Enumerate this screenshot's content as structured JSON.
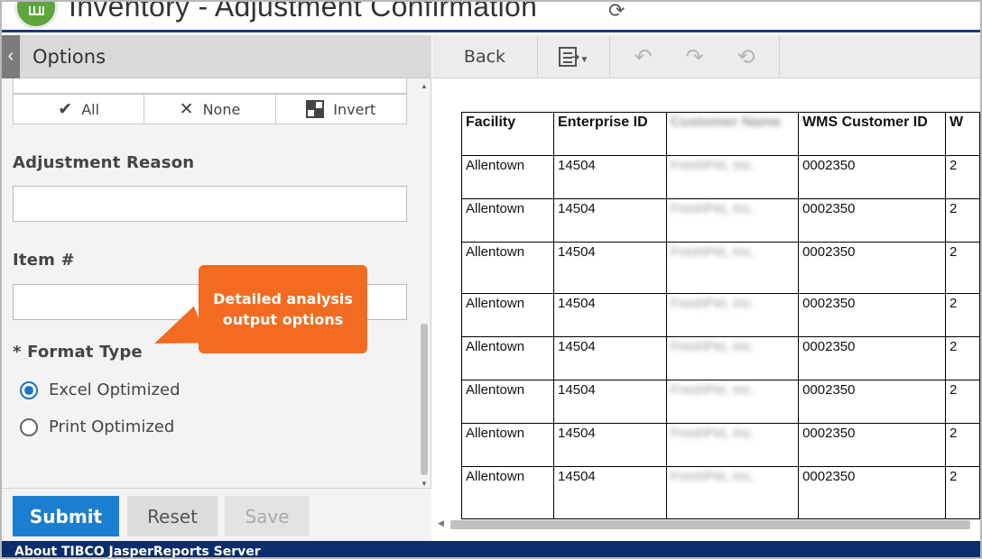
{
  "app": {
    "title": "Inventory - Adjustment Confirmation"
  },
  "options_panel": {
    "title": "Options",
    "select_buttons": {
      "all": "All",
      "none": "None",
      "invert": "Invert"
    },
    "adjustment_reason": {
      "label": "Adjustment Reason",
      "value": ""
    },
    "item_number": {
      "label": "Item #",
      "value": ""
    },
    "format_type": {
      "label": "* Format Type",
      "options": [
        {
          "label": "Excel Optimized",
          "selected": true
        },
        {
          "label": "Print Optimized",
          "selected": false
        }
      ]
    },
    "buttons": {
      "submit": "Submit",
      "reset": "Reset",
      "save": "Save"
    }
  },
  "callout": {
    "line1": "Detailed analysis",
    "line2": "output options"
  },
  "viewer_toolbar": {
    "back": "Back"
  },
  "report": {
    "columns": [
      "Facility",
      "Enterprise ID",
      "Customer Name",
      "WMS Customer ID",
      "W"
    ],
    "rows": [
      [
        "Allentown",
        "14504",
        "FreshPet, Inc.",
        "0002350",
        "2"
      ],
      [
        "Allentown",
        "14504",
        "FreshPet, Inc.",
        "0002350",
        "2"
      ],
      [
        "Allentown",
        "14504",
        "FreshPet, Inc.",
        "0002350",
        "2"
      ],
      [
        "Allentown",
        "14504",
        "FreshPet, Inc.",
        "0002350",
        "2"
      ],
      [
        "Allentown",
        "14504",
        "FreshPet, Inc.",
        "0002350",
        "2"
      ],
      [
        "Allentown",
        "14504",
        "FreshPet, Inc.",
        "0002350",
        "2"
      ],
      [
        "Allentown",
        "14504",
        "FreshPet, Inc.",
        "0002350",
        "2"
      ],
      [
        "Allentown",
        "14504",
        "FreshPet, Inc.",
        "0002350",
        "2"
      ]
    ]
  },
  "footer": {
    "about": "About TIBCO JasperReports Server"
  },
  "colors": {
    "header_underline": "#1d3c78",
    "submit_blue": "#1a7fd1",
    "callout_orange": "#f26b21",
    "footer_navy": "#0c2d6b"
  }
}
